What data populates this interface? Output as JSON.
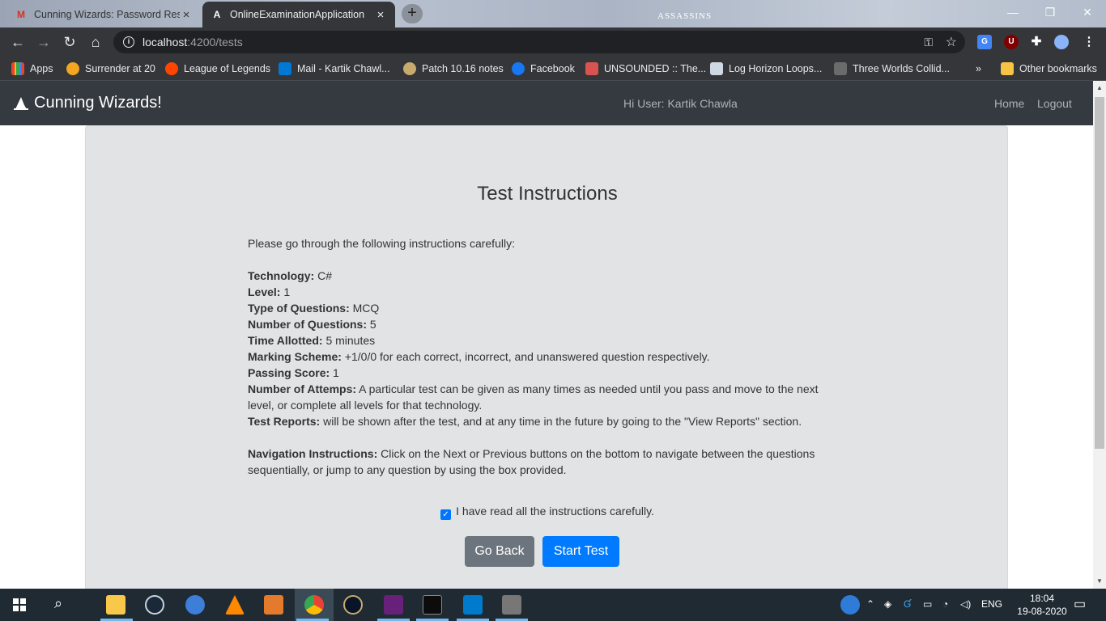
{
  "browser": {
    "tabs": [
      {
        "title": "Cunning Wizards: Password Rese",
        "favicon": "gmail-icon",
        "active": false
      },
      {
        "title": "OnlineExaminationApplication",
        "favicon": "angular-icon",
        "active": true
      }
    ],
    "new_tab_glyph": "+",
    "wallpaper_logo": "ASSASSINS",
    "url_host": "localhost",
    "url_path": ":4200/tests",
    "bookmarks": [
      {
        "label": "Apps",
        "icon": "apps-grid-icon",
        "color": "#4285f4"
      },
      {
        "label": "Surrender at 20",
        "icon": "surrender-icon",
        "color": "#f4a522"
      },
      {
        "label": "League of Legends",
        "icon": "reddit-icon",
        "color": "#ff4500"
      },
      {
        "label": "Mail - Kartik Chawl...",
        "icon": "outlook-icon",
        "color": "#0078d4"
      },
      {
        "label": "Patch 10.16 notes",
        "icon": "league-icon",
        "color": "#c8aa6e"
      },
      {
        "label": "Facebook",
        "icon": "facebook-icon",
        "color": "#1877f2"
      },
      {
        "label": "UNSOUNDED :: The...",
        "icon": "unsounded-icon",
        "color": "#d9534f"
      },
      {
        "label": "Log Horizon Loops...",
        "icon": "building-icon",
        "color": "#cfd8e3"
      },
      {
        "label": "Three Worlds Collid...",
        "icon": "lw-icon",
        "color": "#6b6b6b"
      }
    ],
    "overflow_glyph": "»",
    "other_bookmarks": "Other bookmarks"
  },
  "app": {
    "brand": "Cunning Wizards!",
    "greeting": "Hi User: Kartik Chawla",
    "nav": {
      "home": "Home",
      "logout": "Logout"
    }
  },
  "instructions": {
    "title": "Test Instructions",
    "intro": "Please go through the following instructions carefully:",
    "items": [
      {
        "label": "Technology:",
        "value": " C#"
      },
      {
        "label": "Level:",
        "value": " 1"
      },
      {
        "label": "Type of Questions:",
        "value": " MCQ"
      },
      {
        "label": "Number of Questions:",
        "value": " 5"
      },
      {
        "label": "Time Allotted:",
        "value": " 5 minutes"
      },
      {
        "label": "Marking Scheme:",
        "value": " +1/0/0 for each correct, incorrect, and unanswered question respectively."
      },
      {
        "label": "Passing Score:",
        "value": " 1"
      },
      {
        "label": "Number of Attemps:",
        "value": " A particular test can be given as many times as needed until you pass and move to the next level, or complete all levels for that technology."
      },
      {
        "label": "Test Reports:",
        "value": " will be shown after the test, and at any time in the future by going to the \"View Reports\" section."
      }
    ],
    "navigation": {
      "label": "Navigation Instructions:",
      "value": " Click on the Next or Previous buttons on the bottom to navigate between the questions sequentially, or jump to any question by using the box provided."
    },
    "checkbox_label": "I have read all the instructions carefully.",
    "checkbox_checked": true,
    "buttons": {
      "back": "Go Back",
      "start": "Start Test"
    }
  },
  "taskbar": {
    "language": "ENG",
    "time": "18:04",
    "date": "19-08-2020"
  }
}
